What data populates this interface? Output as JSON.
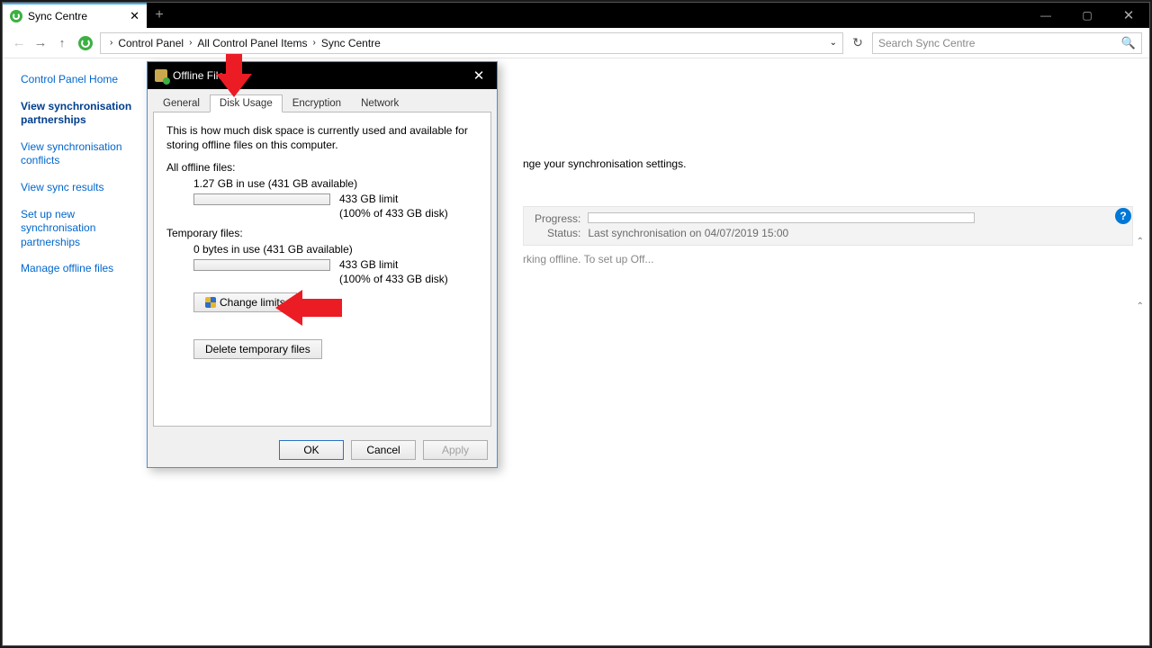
{
  "window": {
    "tab_title": "Sync Centre",
    "newtab_glyph": "+",
    "minimize_glyph": "—",
    "maximize_glyph": "▢",
    "close_glyph": "✕"
  },
  "toolbar": {
    "back_glyph": "←",
    "forward_glyph": "→",
    "up_glyph": "↑",
    "crumb1": "Control Panel",
    "crumb2": "All Control Panel Items",
    "crumb3": "Sync Centre",
    "sep": "›",
    "dropdown_glyph": "⌄",
    "refresh_glyph": "↻",
    "search_placeholder": "Search Sync Centre",
    "search_glyph": "🔍"
  },
  "sidebar": {
    "home": "Control Panel Home",
    "links": [
      "View synchronisation partnerships",
      "View synchronisation conflicts",
      "View sync results",
      "Set up new synchronisation partnerships",
      "Manage offline files"
    ]
  },
  "main": {
    "heading_fragment": "nge your synchronisation settings.",
    "progress_label": "Progress:",
    "status_label": "Status:",
    "status_value": "Last synchronisation on 04/07/2019 15:00",
    "offline_fragment": "rking offline. To set up Off...",
    "help_glyph": "?",
    "caret_glyph": "⌃"
  },
  "dialog": {
    "title": "Offline Files",
    "close_glyph": "✕",
    "tabs": [
      "General",
      "Disk Usage",
      "Encryption",
      "Network"
    ],
    "active_tab": 1,
    "desc": "This is how much disk space is currently used and available for storing offline files on this computer.",
    "all_label": "All offline files:",
    "all_usage": "1.27 GB in use (431 GB available)",
    "all_limit": "433 GB limit",
    "all_percent": "(100% of 433 GB disk)",
    "temp_label": "Temporary files:",
    "temp_usage": "0 bytes in use (431 GB available)",
    "temp_limit": "433 GB limit",
    "temp_percent": "(100% of 433 GB disk)",
    "change_btn": "Change limits",
    "delete_btn": "Delete temporary files",
    "ok": "OK",
    "cancel": "Cancel",
    "apply": "Apply"
  }
}
